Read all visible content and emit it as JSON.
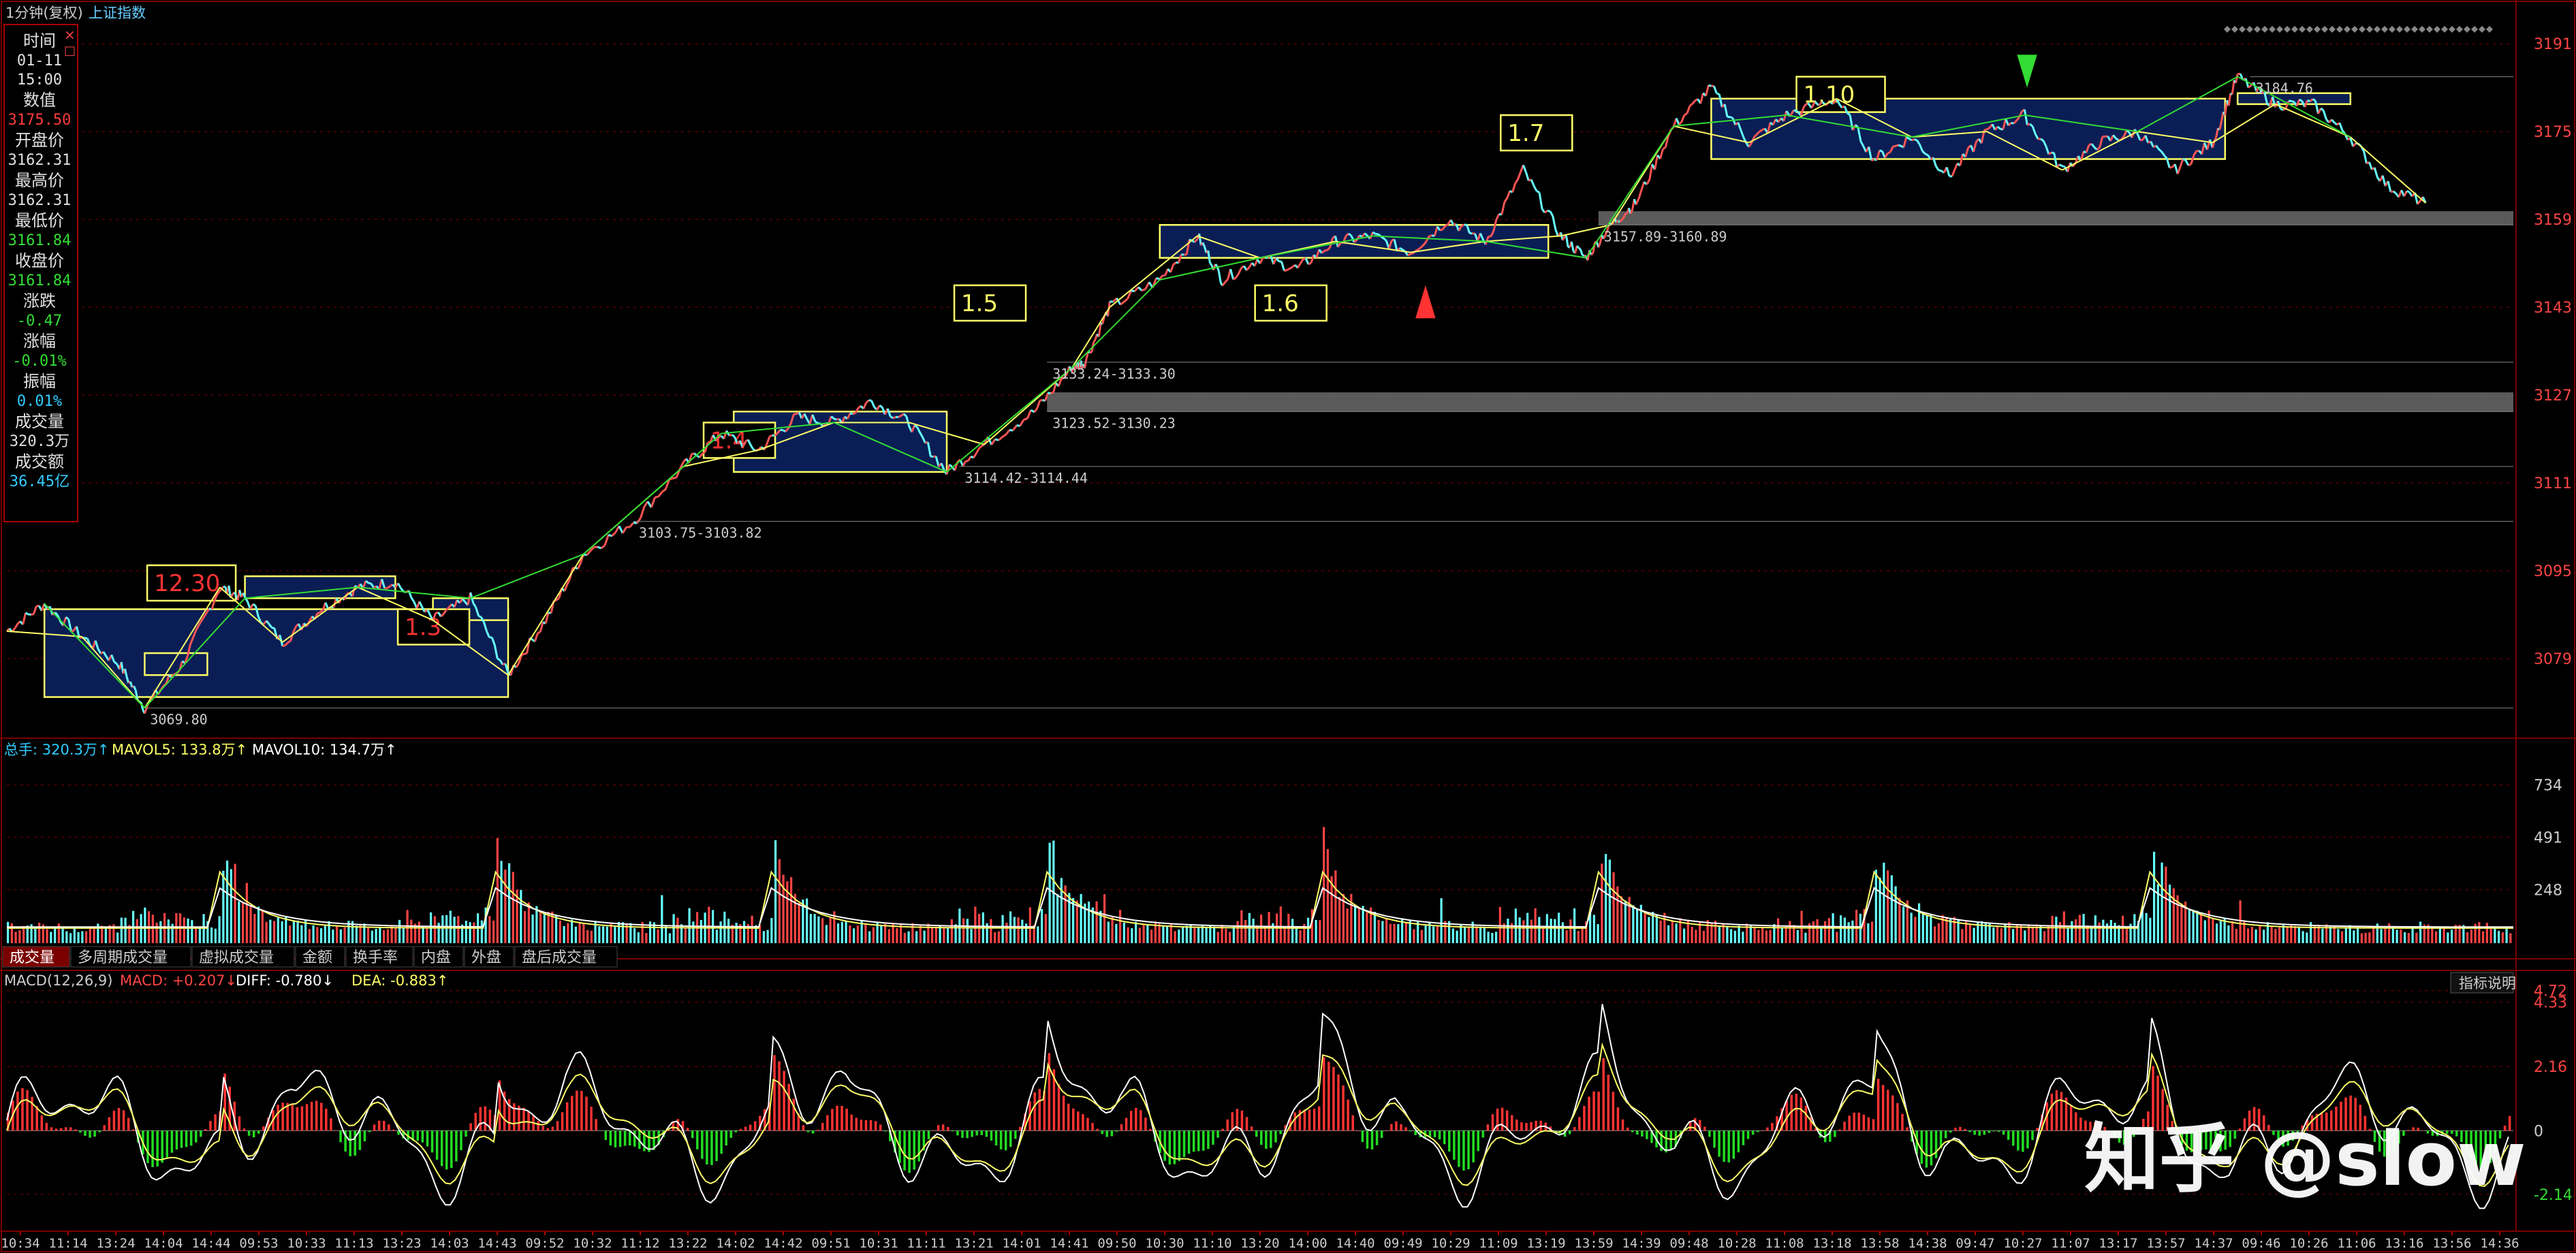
{
  "header": {
    "title": "1分钟(复权)",
    "index_name": "上证指数",
    "price_ticks": [
      "3191",
      "3175",
      "3159",
      "3143",
      "3127",
      "3111",
      "3095",
      "3079"
    ]
  },
  "info_panel": {
    "close_glyph": "×",
    "pin_glyph": "□",
    "rows": [
      {
        "label": "时间",
        "value": "01-11\n15:00",
        "value_color": "#e0e0e0"
      },
      {
        "label": "数值",
        "value": "3175.50",
        "value_color": "#ff3b3b"
      },
      {
        "label": "开盘价",
        "value": "3162.31",
        "value_color": "#e0e0e0"
      },
      {
        "label": "最高价",
        "value": "3162.31",
        "value_color": "#e0e0e0"
      },
      {
        "label": "最低价",
        "value": "3161.84",
        "value_color": "#33dd33"
      },
      {
        "label": "收盘价",
        "value": "3161.84",
        "value_color": "#33dd33"
      },
      {
        "label": "涨跌",
        "value": "-0.47",
        "value_color": "#33dd33"
      },
      {
        "label": "涨幅",
        "value": "-0.01%",
        "value_color": "#33dd33"
      },
      {
        "label": "振幅",
        "value": "0.01%",
        "value_color": "#33ccff"
      },
      {
        "label": "成交量",
        "value": "320.3万",
        "value_color": "#e0e0e0"
      },
      {
        "label": "成交额",
        "value": "36.45亿",
        "value_color": "#33ccff"
      }
    ]
  },
  "volume_panel": {
    "legend": [
      {
        "text": "总手: 320.3万↑",
        "color": "#33ccff"
      },
      {
        "text": "MAVOL5: 133.8万↑",
        "color": "#ffff66"
      },
      {
        "text": "MAVOL10: 134.7万↑",
        "color": "#ffffff"
      }
    ],
    "ticks": [
      "734",
      "491",
      "248"
    ]
  },
  "tabs": [
    {
      "label": "成交量",
      "active": true
    },
    {
      "label": "多周期成交量",
      "active": false
    },
    {
      "label": "虚拟成交量",
      "active": false
    },
    {
      "label": "金额",
      "active": false
    },
    {
      "label": "换手率",
      "active": false
    },
    {
      "label": "内盘",
      "active": false
    },
    {
      "label": "外盘",
      "active": false
    },
    {
      "label": "盘后成交量",
      "active": false
    }
  ],
  "macd_panel": {
    "legend": [
      {
        "text": "MACD(12,26,9)",
        "color": "#cccccc"
      },
      {
        "text": "MACD: +0.207↓",
        "color": "#ff4444"
      },
      {
        "text": "DIFF: -0.780↓",
        "color": "#ffffff"
      },
      {
        "text": "DEA: -0.883↑",
        "color": "#ffff66"
      }
    ],
    "ticks": [
      {
        "text": "4.72",
        "color": "#ff4444"
      },
      {
        "text": "4.33",
        "color": "#ff4444"
      },
      {
        "text": "2.16",
        "color": "#ff4444"
      },
      {
        "text": "0",
        "color": "#cccccc"
      },
      {
        "text": "-2.14",
        "color": "#33dd33"
      }
    ],
    "indicator_button": "指标说明"
  },
  "time_axis": [
    "10:34",
    "11:14",
    "13:24",
    "14:04",
    "14:44",
    "09:53",
    "10:33",
    "11:13",
    "13:23",
    "14:03",
    "14:43",
    "09:52",
    "10:32",
    "11:12",
    "13:22",
    "14:02",
    "14:42",
    "09:51",
    "10:31",
    "11:11",
    "13:21",
    "14:01",
    "14:41",
    "09:50",
    "10:30",
    "11:10",
    "13:20",
    "14:00",
    "14:40",
    "09:49",
    "10:29",
    "11:09",
    "13:19",
    "13:59",
    "14:39",
    "09:48",
    "10:28",
    "11:08",
    "13:18",
    "13:58",
    "14:38",
    "09:47",
    "10:27",
    "11:07",
    "13:17",
    "13:57",
    "14:37",
    "09:46",
    "10:26",
    "11:06",
    "13:16",
    "13:56",
    "14:36"
  ],
  "watermark": "知乎 @slow",
  "colors": {
    "up": "#ff3333",
    "down": "#33cc33",
    "cyan": "#66ffff",
    "box": "#ffff66",
    "box_fill": "#0a1e55",
    "grid": "#550000"
  },
  "chart_data": {
    "type": "line",
    "title": "上证指数 1分钟(复权)",
    "ylim": [
      3065,
      3195
    ],
    "price_path": [
      [
        0,
        3084
      ],
      [
        1.5,
        3089
      ],
      [
        3,
        3083
      ],
      [
        4.5,
        3078
      ],
      [
        5.5,
        3070
      ],
      [
        7,
        3078
      ],
      [
        8.5,
        3092
      ],
      [
        9.5,
        3090
      ],
      [
        11,
        3082
      ],
      [
        12.5,
        3088
      ],
      [
        14,
        3092
      ],
      [
        15.5,
        3093
      ],
      [
        17,
        3086
      ],
      [
        18.5,
        3090
      ],
      [
        20,
        3076
      ],
      [
        21.5,
        3086
      ],
      [
        23,
        3098
      ],
      [
        25,
        3104
      ],
      [
        27,
        3114
      ],
      [
        28.5,
        3120
      ],
      [
        30,
        3117
      ],
      [
        31.5,
        3123
      ],
      [
        33,
        3122
      ],
      [
        34.5,
        3126
      ],
      [
        36,
        3122
      ],
      [
        37.5,
        3113
      ],
      [
        39,
        3118
      ],
      [
        41,
        3124
      ],
      [
        42.5,
        3132
      ],
      [
        43,
        3133
      ],
      [
        44,
        3143
      ],
      [
        46,
        3148
      ],
      [
        47.5,
        3156
      ],
      [
        48.5,
        3148
      ],
      [
        50,
        3152
      ],
      [
        51.5,
        3150
      ],
      [
        53,
        3155
      ],
      [
        54.5,
        3156
      ],
      [
        56,
        3153
      ],
      [
        57.5,
        3159
      ],
      [
        59,
        3155
      ],
      [
        60.5,
        3168
      ],
      [
        62,
        3156
      ],
      [
        63,
        3152
      ],
      [
        64,
        3158
      ],
      [
        65,
        3162
      ],
      [
        66.5,
        3176
      ],
      [
        68,
        3183
      ],
      [
        69.5,
        3173
      ],
      [
        71,
        3178
      ],
      [
        73,
        3181
      ],
      [
        74.5,
        3170
      ],
      [
        76,
        3174
      ],
      [
        77.5,
        3167
      ],
      [
        79,
        3175
      ],
      [
        80.5,
        3178
      ],
      [
        82,
        3168
      ],
      [
        83.5,
        3173
      ],
      [
        85,
        3175
      ],
      [
        86.5,
        3168
      ],
      [
        88,
        3173
      ],
      [
        89,
        3185
      ],
      [
        90.5,
        3180
      ],
      [
        92,
        3180
      ],
      [
        93.5,
        3174
      ],
      [
        95,
        3165
      ],
      [
        96.5,
        3162
      ]
    ],
    "boxes": [
      {
        "label": "12.30",
        "label_color": "#ff3333",
        "x": [
          1.5,
          20
        ],
        "y": [
          3072,
          3088
        ]
      },
      {
        "label": "",
        "x": [
          9.5,
          15.5
        ],
        "y": [
          3090,
          3094
        ]
      },
      {
        "label": "",
        "x": [
          5.5,
          8
        ],
        "y": [
          3076,
          3080
        ]
      },
      {
        "label": "1.3",
        "label_color": "#ff3333",
        "x": [
          17,
          20
        ],
        "y": [
          3086,
          3090
        ]
      },
      {
        "label": "1.4",
        "label_color": "#ff3333",
        "x": [
          29,
          37.5
        ],
        "y": [
          3113,
          3124
        ]
      },
      {
        "label": "1.5",
        "label_color": "#ffff66",
        "x": [],
        "y": []
      },
      {
        "label": "1.6",
        "label_color": "#ffff66",
        "x": [
          46,
          61.5
        ],
        "y": [
          3152,
          3158
        ]
      },
      {
        "label": "1.7",
        "label_color": "#ffff66",
        "x": [],
        "y": []
      },
      {
        "label": "1.10",
        "label_color": "#ffff66",
        "x": [
          68,
          88.5
        ],
        "y": [
          3170,
          3181
        ]
      },
      {
        "label": "",
        "x": [
          89,
          93.5
        ],
        "y": [
          3180,
          3182
        ]
      }
    ],
    "levels": [
      {
        "text": "3069.80",
        "x": 5.5,
        "y": 3070
      },
      {
        "text": "3103.75-3103.82",
        "x": 25,
        "y": 3104
      },
      {
        "text": "3114.42-3114.44",
        "x": 38,
        "y": 3114
      },
      {
        "text": "3123.52-3130.23",
        "x": 41.5,
        "y": 3124
      },
      {
        "text": "3133.24-3133.30",
        "x": 41.5,
        "y": 3133
      },
      {
        "text": "3157.89-3160.89",
        "x": 63.5,
        "y": 3158
      },
      {
        "text": "3184.76",
        "x": 89.5,
        "y": 3185
      }
    ],
    "zones": [
      {
        "x": [
          41.5,
          100
        ],
        "y": [
          3124,
          3127.5
        ]
      },
      {
        "x": [
          63.5,
          100
        ],
        "y": [
          3158,
          3160.5
        ]
      }
    ],
    "volume_ylim": [
      0,
      900
    ],
    "volume_peaks": [
      8.5,
      19.5,
      30.5,
      41.5,
      52.5,
      63.5,
      74.5,
      85.5
    ],
    "macd_ylim": [
      -3.2,
      5.1
    ]
  }
}
